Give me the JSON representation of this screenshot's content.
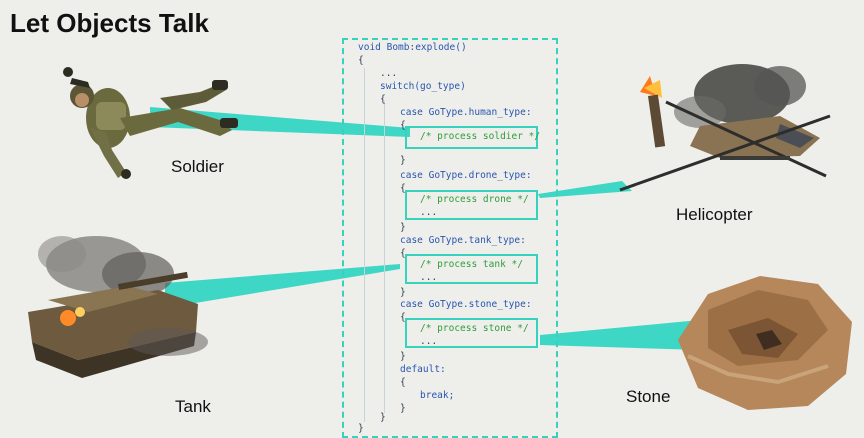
{
  "title": "Let Objects Talk",
  "accent_color": "#36d2bd",
  "objects": [
    {
      "label": "Soldier",
      "icon": "soldier-icon"
    },
    {
      "label": "Helicopter",
      "icon": "helicopter-icon"
    },
    {
      "label": "Tank",
      "icon": "tank-icon"
    },
    {
      "label": "Stone",
      "icon": "stone-icon"
    }
  ],
  "code": {
    "lines": [
      "void Bomb:explode()",
      "{",
      "...",
      "switch(go_type)",
      "{",
      "case GoType.human_type:",
      "{",
      "/* process soldier */",
      "}",
      "case GoType.drone_type:",
      "{",
      "/* process drone */",
      "...",
      "}",
      "case GoType.tank_type:",
      "{",
      "/* process tank */",
      "...",
      "}",
      "case GoType.stone_type:",
      "{",
      "/* process stone */",
      "...",
      "}",
      "default:",
      "{",
      "break;",
      "}",
      "}",
      "}"
    ]
  }
}
